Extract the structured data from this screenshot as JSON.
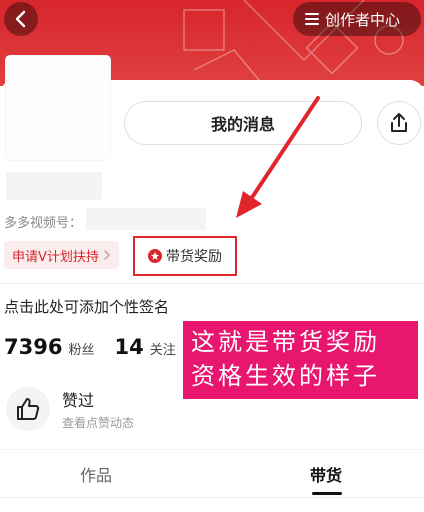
{
  "header": {
    "creator_center_label": "创作者中心"
  },
  "profile": {
    "message_button_label": "我的消息",
    "duoduo_id_label": "多多视频号："
  },
  "tags": {
    "v_plan_label": "申请V计划扶持",
    "reward_label": "带货奖励"
  },
  "signature_placeholder": "点击此处可添加个性签名",
  "stats": {
    "fans_count": "7396",
    "fans_label": "粉丝",
    "following_count": "14",
    "following_label": "关注"
  },
  "overlay_text": {
    "line1": "这就是带货奖励",
    "line2": "资格生效的样子"
  },
  "likes": {
    "title": "赞过",
    "subtitle": "查看点赞动态"
  },
  "tabs": [
    {
      "label": "作品"
    },
    {
      "label": "带货"
    }
  ],
  "colors": {
    "brand_red": "#d7262c",
    "annotation_red": "#e0262c",
    "overlay_pink": "#e8166e"
  }
}
